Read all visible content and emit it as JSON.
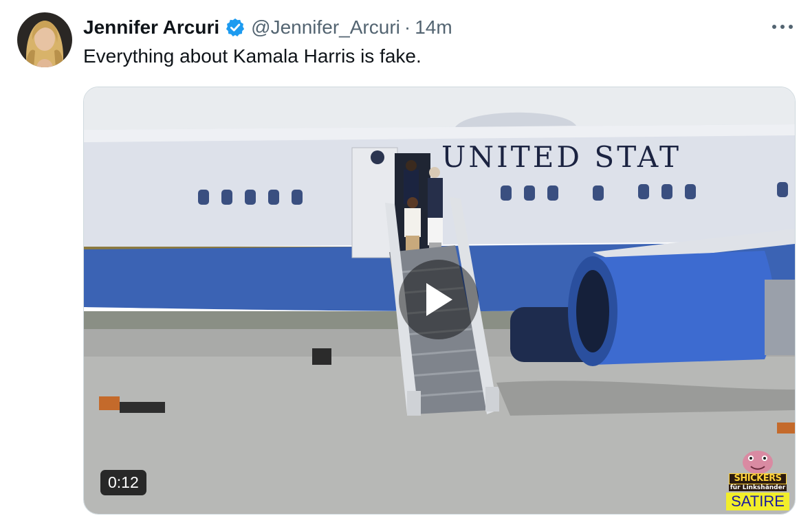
{
  "author": {
    "display_name": "Jennifer Arcuri",
    "handle": "@Jennifer_Arcuri",
    "time_separator": "·",
    "time": "14m",
    "verified_icon": "verified-badge-icon",
    "avatar_icon": "avatar-photo"
  },
  "tweet": {
    "text": "Everything about Kamala Harris is fake."
  },
  "media": {
    "aircraft_lettering": "UNITED STAT",
    "duration": "0:12",
    "play_icon": "play-icon",
    "watermark": {
      "title": "SHICKERS",
      "subtitle": "für Linkshänder",
      "label": "SATIRE"
    }
  },
  "actions": {
    "more_icon": "more-horizontal-icon"
  },
  "colors": {
    "verified": "#1d9bf0",
    "secondary_text": "#536471",
    "border": "#cfd9de",
    "watermark_bg": "#f2ee2a"
  }
}
